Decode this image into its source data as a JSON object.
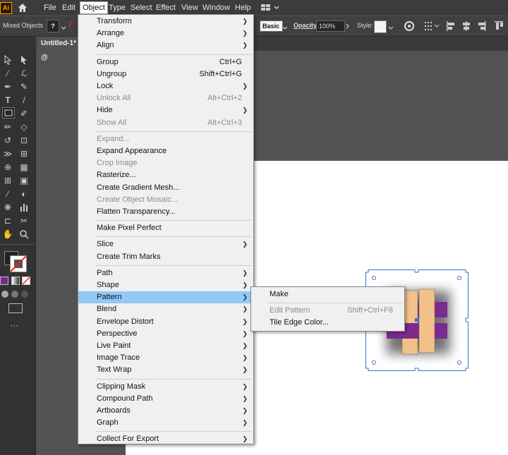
{
  "app": {
    "logo_text": "Ai"
  },
  "menubar": {
    "items": [
      "File",
      "Edit",
      "Object",
      "Type",
      "Select",
      "Effect",
      "View",
      "Window",
      "Help"
    ],
    "active": "Object"
  },
  "control_bar": {
    "selection_label": "Mixed Objects",
    "stroke_style": "Basic",
    "opacity_label": "Opacity:",
    "opacity_value": "100%",
    "style_label": "Style:"
  },
  "document": {
    "tab_title": "Untitled-1* @"
  },
  "object_menu": {
    "items": [
      {
        "label": "Transform",
        "submenu": true
      },
      {
        "label": "Arrange",
        "submenu": true
      },
      {
        "label": "Align",
        "submenu": true
      },
      {
        "separator": true
      },
      {
        "label": "Group",
        "shortcut": "Ctrl+G"
      },
      {
        "label": "Ungroup",
        "shortcut": "Shift+Ctrl+G"
      },
      {
        "label": "Lock",
        "submenu": true
      },
      {
        "label": "Unlock All",
        "shortcut": "Alt+Ctrl+2",
        "disabled": true
      },
      {
        "label": "Hide",
        "submenu": true
      },
      {
        "label": "Show All",
        "shortcut": "Alt+Ctrl+3",
        "disabled": true
      },
      {
        "separator": true
      },
      {
        "label": "Expand...",
        "disabled": true
      },
      {
        "label": "Expand Appearance"
      },
      {
        "label": "Crop Image",
        "disabled": true
      },
      {
        "label": "Rasterize..."
      },
      {
        "label": "Create Gradient Mesh..."
      },
      {
        "label": "Create Object Mosaic...",
        "disabled": true
      },
      {
        "label": "Flatten Transparency..."
      },
      {
        "separator": true
      },
      {
        "label": "Make Pixel Perfect"
      },
      {
        "separator": true
      },
      {
        "label": "Slice",
        "submenu": true
      },
      {
        "label": "Create Trim Marks"
      },
      {
        "separator": true
      },
      {
        "label": "Path",
        "submenu": true
      },
      {
        "label": "Shape",
        "submenu": true
      },
      {
        "label": "Pattern",
        "submenu": true,
        "highlighted": true
      },
      {
        "label": "Blend",
        "submenu": true
      },
      {
        "label": "Envelope Distort",
        "submenu": true
      },
      {
        "label": "Perspective",
        "submenu": true
      },
      {
        "label": "Live Paint",
        "submenu": true
      },
      {
        "label": "Image Trace",
        "submenu": true
      },
      {
        "label": "Text Wrap",
        "submenu": true
      },
      {
        "separator": true
      },
      {
        "label": "Clipping Mask",
        "submenu": true
      },
      {
        "label": "Compound Path",
        "submenu": true
      },
      {
        "label": "Artboards",
        "submenu": true
      },
      {
        "label": "Graph",
        "submenu": true
      },
      {
        "separator": true
      },
      {
        "label": "Collect For Export",
        "submenu": true
      }
    ]
  },
  "pattern_submenu": {
    "items": [
      {
        "label": "Make"
      },
      {
        "separator": true
      },
      {
        "label": "Edit Pattern",
        "shortcut": "Shift+Ctrl+F8",
        "disabled": true
      },
      {
        "label": "Tile Edge Color..."
      }
    ]
  },
  "colors": {
    "menu_highlight": "#91c9f7",
    "selection_blue": "#3a6fd8",
    "weave_purple": "#7b2a8f",
    "weave_peach": "#f4c08a"
  }
}
